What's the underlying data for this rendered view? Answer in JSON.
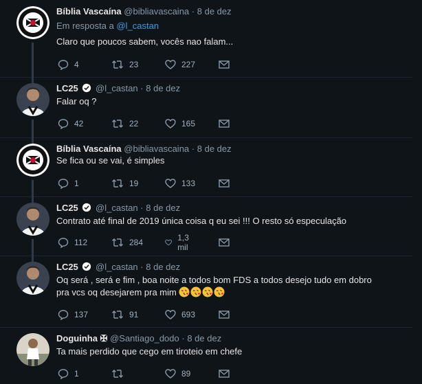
{
  "tweets": [
    {
      "name": "Bíblia Vascaína",
      "handle": "@bibliavascaina",
      "date": "8 de dez",
      "reply_prefix": "Em resposta a",
      "reply_to": "@l_castan",
      "text": "Claro que poucos sabem, vocês nao falam...",
      "replies": "4",
      "retweets": "23",
      "likes": "227"
    },
    {
      "name": "LC25",
      "handle": "@l_castan",
      "date": "8 de dez",
      "text": "Falar oq ?",
      "replies": "42",
      "retweets": "22",
      "likes": "165"
    },
    {
      "name": "Bíblia Vascaína",
      "handle": "@bibliavascaina",
      "date": "8 de dez",
      "text": "Se fica ou se vai, é simples",
      "replies": "1",
      "retweets": "19",
      "likes": "133"
    },
    {
      "name": "LC25",
      "handle": "@l_castan",
      "date": "8 de dez",
      "text": "Contrato até final de 2019 única coisa q eu sei !!! O resto só especulação",
      "replies": "112",
      "retweets": "284",
      "likes": "1,3 mil"
    },
    {
      "name": "LC25",
      "handle": "@l_castan",
      "date": "8 de dez",
      "text_line1": "Oq será , será e fim , boa noite a todos bom FDS a todos desejo tudo em dobro",
      "text_line2": "pra vcs oq desejarem pra mim",
      "replies": "137",
      "retweets": "91",
      "likes": "693"
    },
    {
      "name": "Doguinha ✠",
      "handle": "@Santiago_dodo",
      "date": "8 de dez",
      "text": "Ta mais perdido que cego em tiroteio em chefe",
      "replies": "1",
      "retweets": "",
      "likes": "89"
    }
  ],
  "separator": "·",
  "colors": {
    "background": "#0f1419",
    "link": "#3d9ee0",
    "muted": "#8899a6",
    "verified": "#ffffff"
  },
  "icons": [
    "reply-icon",
    "retweet-icon",
    "like-icon",
    "dm-icon",
    "verified-icon",
    "kiss-emoji-icon"
  ]
}
